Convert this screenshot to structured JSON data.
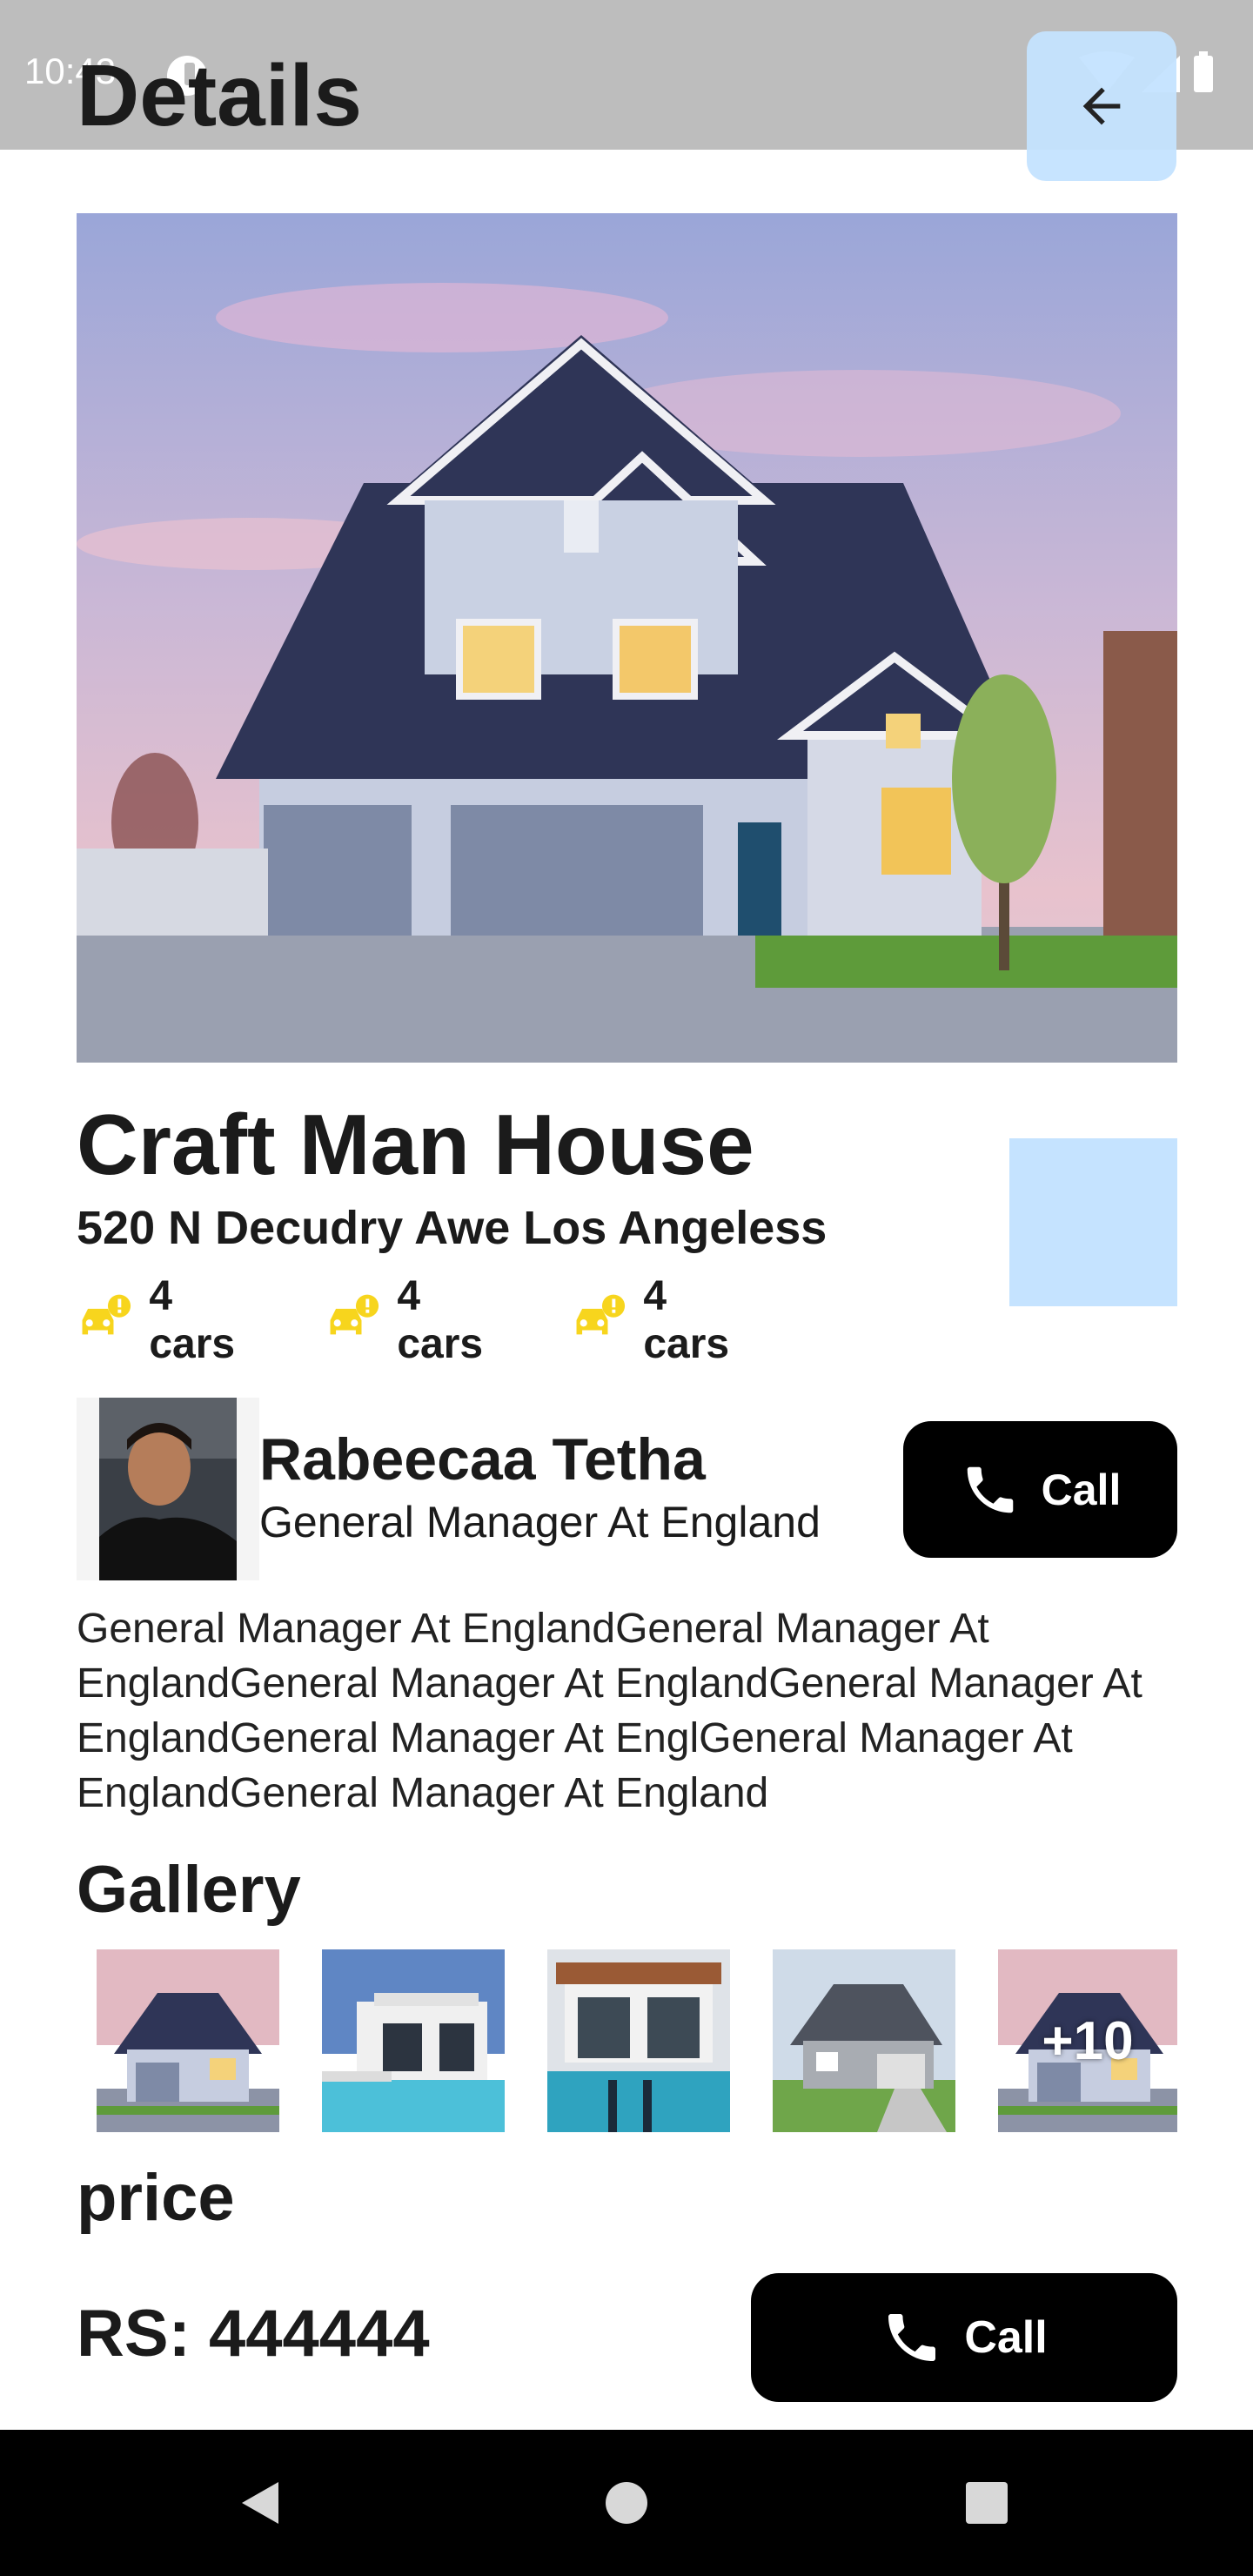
{
  "status_bar": {
    "time": "10:43"
  },
  "header": {
    "title": "Details"
  },
  "property": {
    "name": "Craft Man House",
    "address": "520 N Decudry Awe Los Angeless",
    "features": [
      {
        "label": "4 cars",
        "icon": "car-alert-icon"
      },
      {
        "label": "4 cars",
        "icon": "car-alert-icon"
      },
      {
        "label": "4 cars",
        "icon": "car-alert-icon"
      }
    ],
    "hero_image": "house-photo"
  },
  "agent": {
    "name": "Rabeecaa Tetha",
    "role": "General Manager At England",
    "call_label": "Call"
  },
  "description": "General Manager At EnglandGeneral Manager At EnglandGeneral Manager At EnglandGeneral Manager At EnglandGeneral Manager At EnglGeneral Manager At EnglandGeneral Manager At England",
  "gallery": {
    "title": "Gallery",
    "more_label": "+10",
    "thumbnails": [
      "house-thumb-1",
      "house-thumb-2",
      "house-thumb-3",
      "house-thumb-4",
      "house-thumb-5"
    ]
  },
  "price": {
    "label": "price",
    "value": "RS: 444444",
    "call_label": "Call"
  },
  "colors": {
    "accent_light_blue": "#c5e3ff",
    "feature_icon": "#f7d51d",
    "button_bg": "#000000",
    "status_bar_bg": "#bdbdbd"
  }
}
